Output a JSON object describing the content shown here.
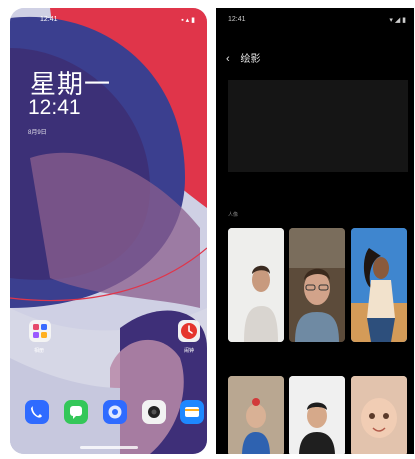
{
  "lock_screen": {
    "status_time": "12:41",
    "weekday": "星期一",
    "clock": "12:41",
    "date": "8月9日",
    "apps": [
      {
        "label": "相册",
        "icon": "gallery-icon"
      },
      {
        "label": "闹钟",
        "icon": "clock-app-icon"
      }
    ],
    "dock": [
      {
        "icon": "phone-icon",
        "color": "#2f6bff"
      },
      {
        "icon": "messages-icon",
        "color": "#34c759"
      },
      {
        "icon": "browser-icon",
        "color": "#2f6bff"
      },
      {
        "icon": "camera-icon",
        "color": "#f2f2f2"
      },
      {
        "icon": "wallet-icon",
        "color": "#1e88ff"
      }
    ]
  },
  "portrait_page": {
    "status_time": "12:41",
    "title": "绘影",
    "banner_text": "",
    "section1_label": "人像",
    "section2_label": "",
    "badge": "",
    "colors": {
      "background": "#000000",
      "badge": "#e23b3b"
    }
  }
}
